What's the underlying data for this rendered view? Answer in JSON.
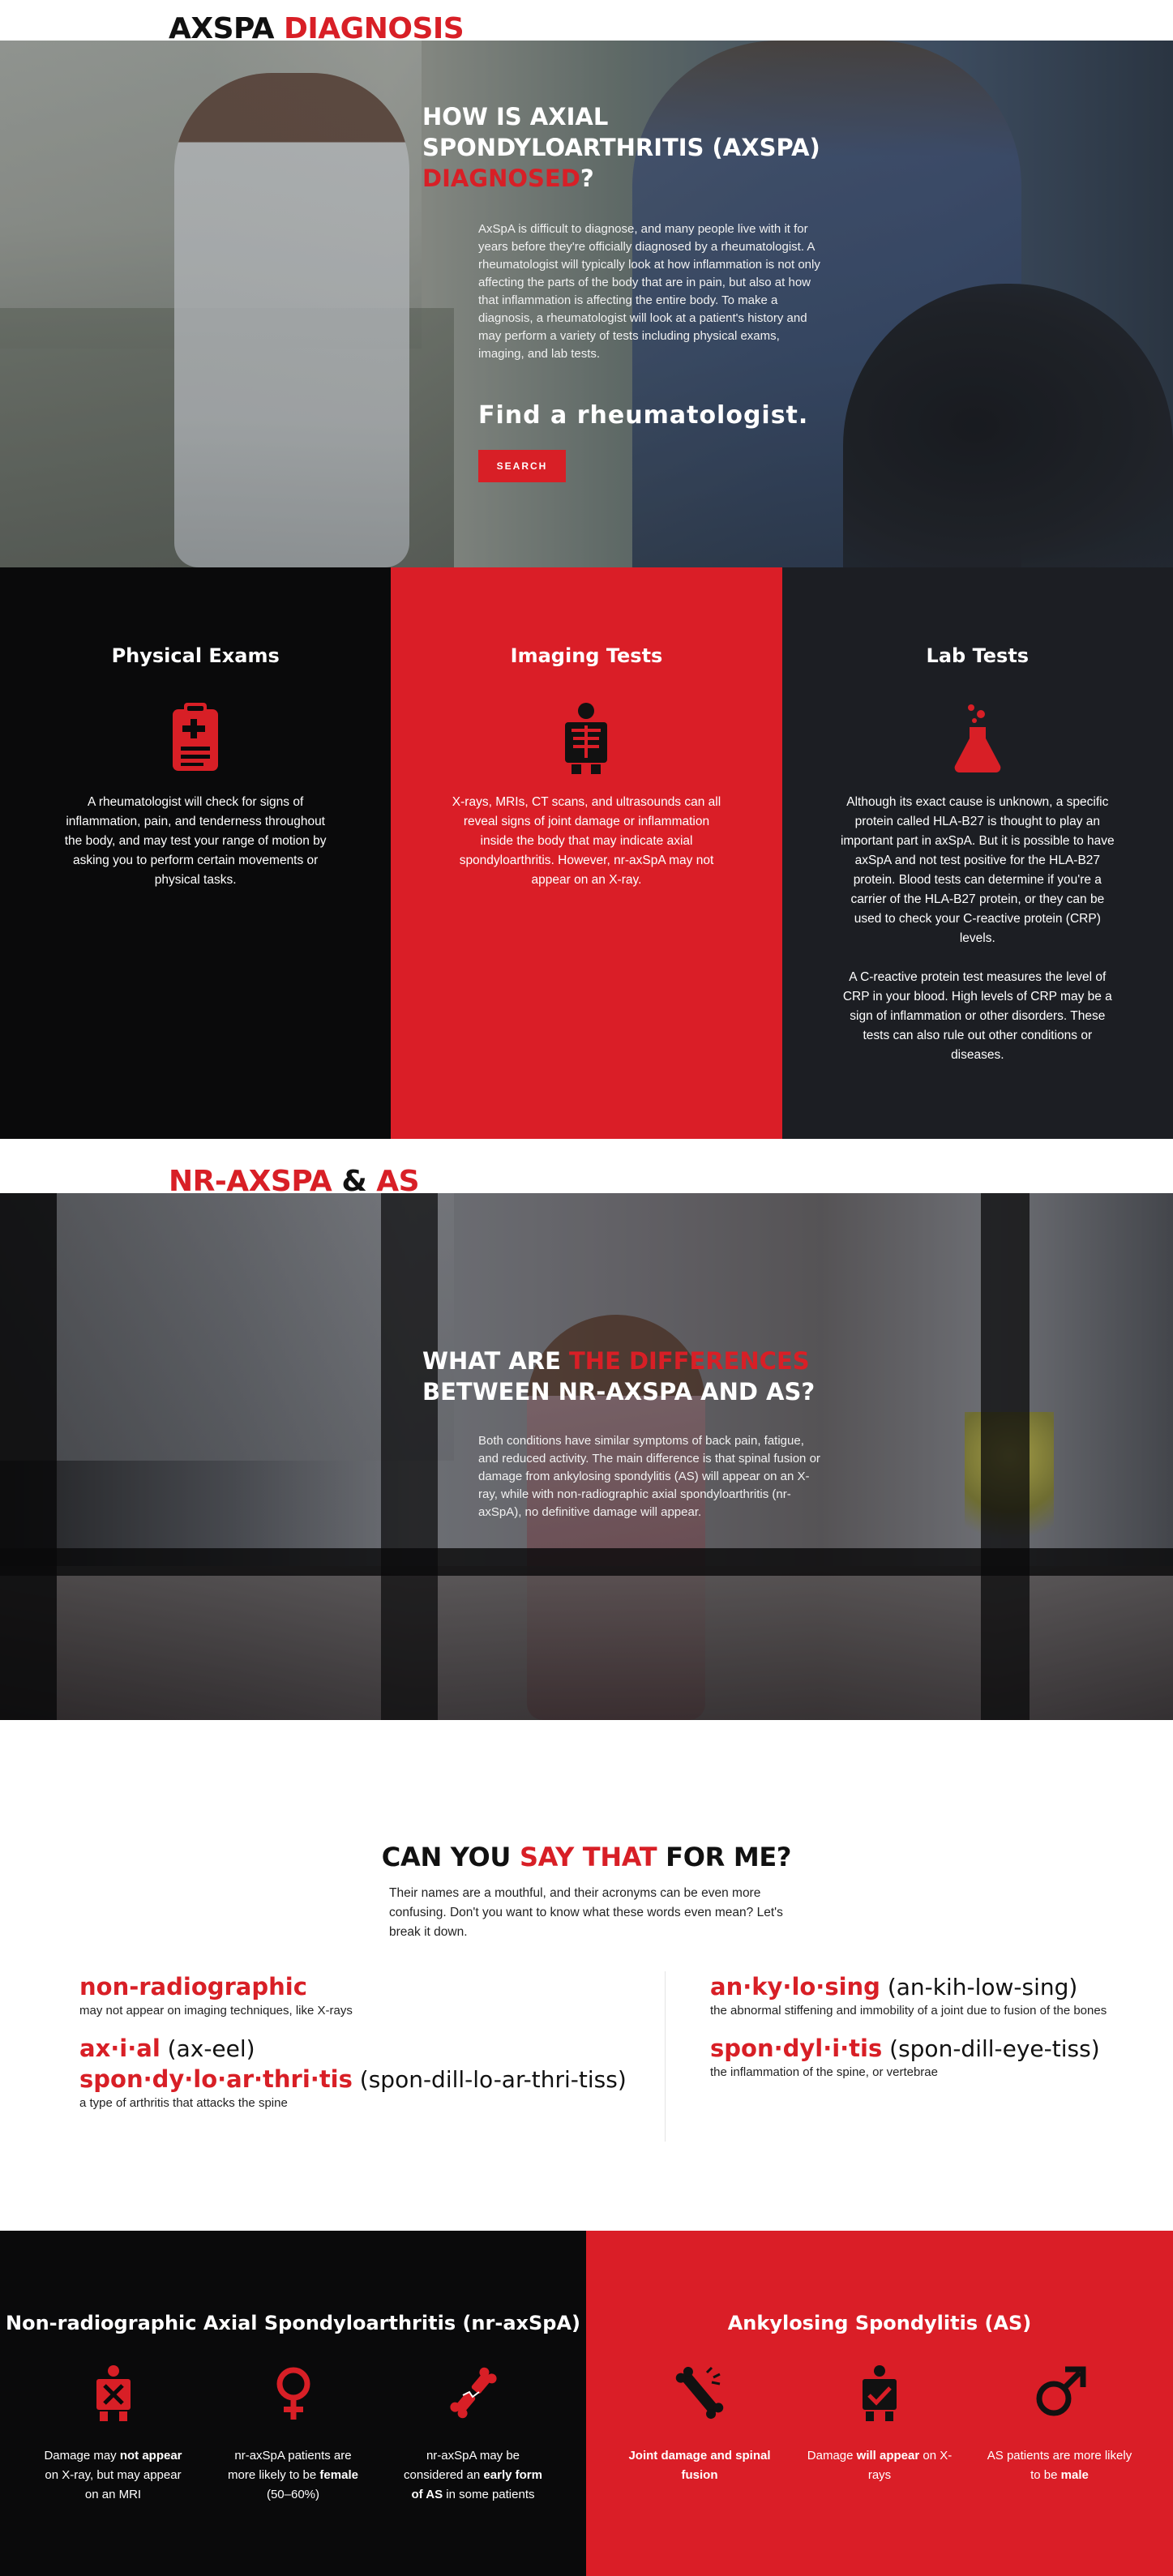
{
  "section1": {
    "heading": {
      "black": "AXSPA ",
      "red": "DIAGNOSIS"
    },
    "hero": {
      "title_white": "HOW IS AXIAL SPONDYLOARTHRITIS (AXSPA) ",
      "title_red": "DIAGNOSED",
      "title_end": "?",
      "body": "AxSpA is difficult to diagnose, and many people live with it for years before they're officially diagnosed by a rheumatologist. A rheumatologist will typically look at how inflammation is not only affecting the parts of the body that are in pain, but also at how that inflammation is affecting the entire body. To make a diagnosis, a rheumatologist will look at a patient's history and may perform a variety of tests including physical exams, imaging, and lab tests.",
      "find": "Find a rheumatologist.",
      "button": "SEARCH"
    }
  },
  "tests": [
    {
      "title": "Physical Exams",
      "icon": "clipboard-icon",
      "body": "A rheumatologist will check for signs of inflammation, pain, and tenderness throughout the body, and may test your range of motion by asking you to perform certain movements or physical tasks."
    },
    {
      "title": "Imaging Tests",
      "icon": "xray-icon",
      "body": "X-rays, MRIs, CT scans, and ultrasounds can all reveal signs of joint damage or inflammation inside the body that may indicate axial spondyloarthritis. However, nr-axSpA may not appear on an X-ray."
    },
    {
      "title": "Lab Tests",
      "icon": "flask-icon",
      "body": "Although its exact cause is unknown, a specific protein called HLA-B27 is thought to play an important part in axSpA. But it is possible to have axSpA and not test positive for the HLA-B27 protein. Blood tests can determine if you're a carrier of the HLA-B27 protein, or they can be used to check your C-reactive protein (CRP) levels.",
      "body2": "A C-reactive protein test measures the level of CRP in your blood. High levels of CRP may be a sign of inflammation or other disorders. These tests can also rule out other conditions or diseases."
    }
  ],
  "section2": {
    "heading": {
      "red1": "NR-AXSPA",
      "mid": " & ",
      "red2": "AS"
    },
    "hero": {
      "title_white1": "WHAT ARE ",
      "title_red": "THE DIFFERENCES",
      "title_white2": " BETWEEN NR-AXSPA AND AS?",
      "body": "Both conditions have similar symptoms of back pain, fatigue, and reduced activity. The main difference is that spinal fusion or damage from ankylosing spondylitis (AS) will appear on an X-ray, while with non-radiographic axial spondyloarthritis (nr-axSpA), no definitive damage will appear."
    }
  },
  "say": {
    "title_black1": "CAN YOU ",
    "title_red": "SAY THAT",
    "title_black2": " FOR ME?",
    "sub": "Their names are a mouthful, and their acronyms can be even more confusing. Don't you want to know what these words even mean? Let's break it down.",
    "left": [
      {
        "word": "non-radiographic",
        "pron": "",
        "def": "may not appear on imaging techniques, like X-rays"
      },
      {
        "word": "ax·i·al",
        "pron": " (ax-eel)",
        "def": ""
      },
      {
        "word": "spon·dy·lo·ar·thri·tis",
        "pron": " (spon-dill-lo-ar-thri-tiss)",
        "def": "a type of arthritis that attacks the spine"
      }
    ],
    "right": [
      {
        "word": "an·ky·lo·sing",
        "pron": " (an-kih-low-sing)",
        "def": "the abnormal stiffening and immobility of a joint due to fusion of the bones"
      },
      {
        "word": "spon·dyl·i·tis",
        "pron": " (spon-dill-eye-tiss)",
        "def": "the inflammation of the spine, or vertebrae"
      }
    ]
  },
  "compare": {
    "nr": {
      "title": "Non-radiographic Axial Spondyloarthritis (nr-axSpA)",
      "items": [
        {
          "icon": "xray-cross-icon",
          "pre": "Damage may ",
          "bold": "not appear",
          "post": " on X-ray, but may appear on an MRI"
        },
        {
          "icon": "female-icon",
          "pre": "nr-axSpA patients are more likely to be ",
          "bold": "female",
          "post": " (50–60%)"
        },
        {
          "icon": "bone-icon",
          "pre": "nr-axSpA may be considered an ",
          "bold": "early form of AS",
          "post": " in some patients"
        }
      ]
    },
    "as": {
      "title": "Ankylosing Spondylitis (AS)",
      "items": [
        {
          "icon": "fused-bone-icon",
          "pre": "",
          "bold": "Joint damage and spinal fusion",
          "post": ""
        },
        {
          "icon": "xray-check-icon",
          "pre": "Damage ",
          "bold": "will appear",
          "post": " on X-rays"
        },
        {
          "icon": "male-icon",
          "pre": "AS patients are more likely to be ",
          "bold": "male",
          "post": ""
        }
      ]
    }
  },
  "colors": {
    "red": "#d81f26",
    "black": "#0a0a0b",
    "charcoal": "#1c1e23"
  }
}
